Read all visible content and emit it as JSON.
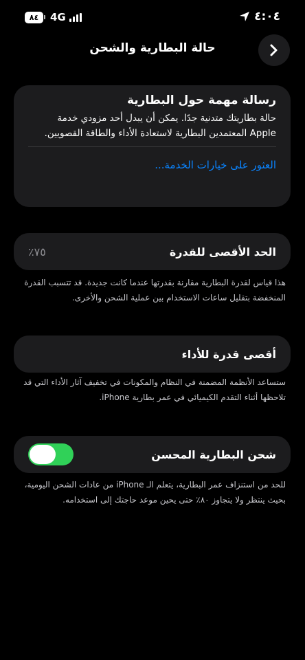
{
  "status_bar": {
    "time": "٤:٠٤",
    "battery": "٨٤",
    "network": "4G"
  },
  "nav": {
    "title": "حالة البطارية والشحن",
    "back_icon": "chevron-icon"
  },
  "battery_message": {
    "title": "رسالة مهمة حول البطارية",
    "body": "حالة بطاريتك متدنية جدًا. يمكن أن يبدل أحد مزودي خدمة Apple المعتمدين البطارية لاستعادة الأداء والطاقة القصويين.",
    "link": "العثور على خيارات الخدمة..."
  },
  "max_capacity": {
    "label": "الحد الأقصى للقدرة",
    "value": "٧٥٪",
    "description": "هذا قياس لقدرة البطارية مقارنة بقدرتها عندما كانت جديدة. قد تتسبب القدرة المنخفضة بتقليل ساعات الاستخدام بين عملية الشحن والأخرى."
  },
  "peak_performance": {
    "label": "أقصى قدرة للأداء",
    "description": "ستساعد الأنظمة المضمنة في النظام والمكونات في تخفيف آثار الأداء التي قد تلاحظها أثناء التقدم الكيميائي في عمر بطارية iPhone."
  },
  "optimized_charging": {
    "label": "شحن البطارية المحسن",
    "enabled": true,
    "description": "للحد من استنزاف عمر البطارية، يتعلم الـ iPhone من عادات الشحن اليومية، بحيث ينتظر ولا يتجاوز ٨٠٪ حتى يحين موعد حاجتك إلى استخدامه."
  },
  "colors": {
    "accent": "#0a84ff",
    "toggle_on": "#30d158",
    "card": "#1c1c1e"
  }
}
